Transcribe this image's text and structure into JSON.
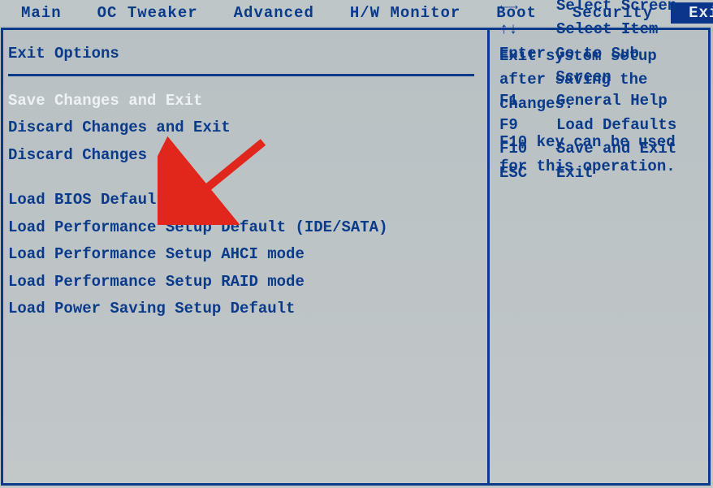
{
  "menubar": {
    "tabs": [
      {
        "label": "Main"
      },
      {
        "label": "OC Tweaker"
      },
      {
        "label": "Advanced"
      },
      {
        "label": "H/W Monitor"
      },
      {
        "label": "Boot"
      },
      {
        "label": "Security"
      },
      {
        "label": "Exit"
      }
    ],
    "active_index": 6
  },
  "left_panel": {
    "title": "Exit Options",
    "group1": [
      "Save Changes and Exit",
      "Discard Changes and Exit",
      "Discard Changes"
    ],
    "selected_index": 0,
    "group2": [
      "Load BIOS Defaults",
      "Load Performance Setup Default (IDE/SATA)",
      "Load Performance Setup AHCI mode",
      "Load Performance Setup RAID mode",
      "Load Power Saving Setup Default"
    ]
  },
  "right_panel": {
    "help1": "Exit system setup after saving the changes.",
    "help2": "F10 key can be used for this operation.",
    "nav": [
      {
        "key": "←→",
        "label": "Select Screen"
      },
      {
        "key": "↑↓",
        "label": "Select Item"
      },
      {
        "key": "Enter",
        "label": "Go to Sub Screen"
      },
      {
        "key": "F1",
        "label": "General Help"
      },
      {
        "key": "F9",
        "label": "Load Defaults"
      },
      {
        "key": "F10",
        "label": "Save and Exit"
      },
      {
        "key": "ESC",
        "label": "Exit"
      }
    ]
  },
  "annotation": {
    "arrow_color": "#e1261c"
  }
}
